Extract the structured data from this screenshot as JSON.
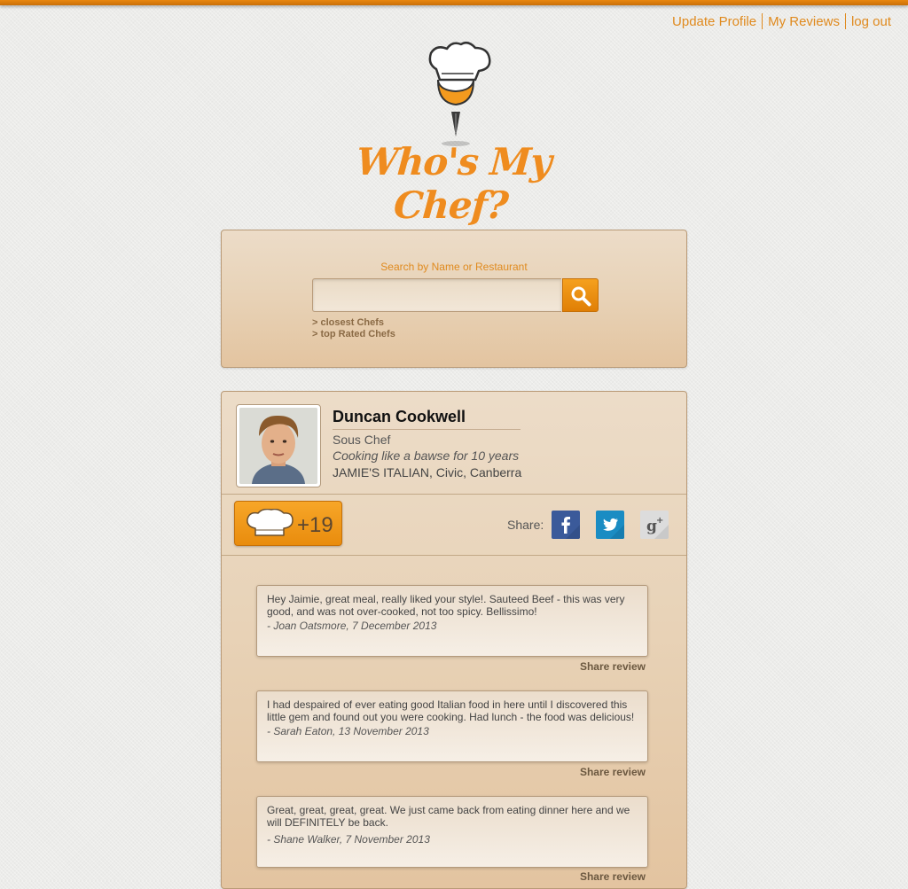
{
  "topnav": {
    "update_profile": "Update Profile",
    "my_reviews": "My Reviews",
    "logout": "log out"
  },
  "logo": {
    "text": "Who's My Chef?",
    "icon": "chef-pin-icon"
  },
  "search": {
    "label": "Search by Name or Restaurant",
    "placeholder": "",
    "value": "",
    "button_icon": "search-icon",
    "links": [
      "> closest Chefs",
      "> top Rated Chefs"
    ]
  },
  "chef": {
    "name": "Duncan Cookwell",
    "role": "Sous Chef",
    "tagline": "Cooking like a bawse for 10 years",
    "location": "JAMIE'S ITALIAN, Civic, Canberra",
    "vote_count": "+19",
    "vote_icon": "chef-hat-icon"
  },
  "share": {
    "label": "Share:",
    "networks": [
      "facebook-icon",
      "twitter-icon",
      "google-plus-icon"
    ]
  },
  "reviews": [
    {
      "text": "Hey Jaimie, great meal, really liked your style!. Sauteed Beef - this was very good, and was not over-cooked, not too spicy. Bellissimo!",
      "meta": "- Joan Oatsmore, 7 December 2013",
      "share_label": "Share review"
    },
    {
      "text": "I had despaired of ever eating good Italian food in here until I discovered this little gem and found out you were cooking. Had lunch - the food was delicious!",
      "meta": "- Sarah Eaton, 13 November 2013",
      "share_label": "Share review"
    },
    {
      "text": "Great, great, great, great. We just came back from eating dinner here and we will DEFINITELY be back.",
      "meta": "- Shane Walker, 7 November 2013",
      "share_label": "Share review"
    }
  ],
  "colors": {
    "accent": "#ef8c1f",
    "topbar": "#e9870f",
    "panel": "#e8d3b8"
  }
}
